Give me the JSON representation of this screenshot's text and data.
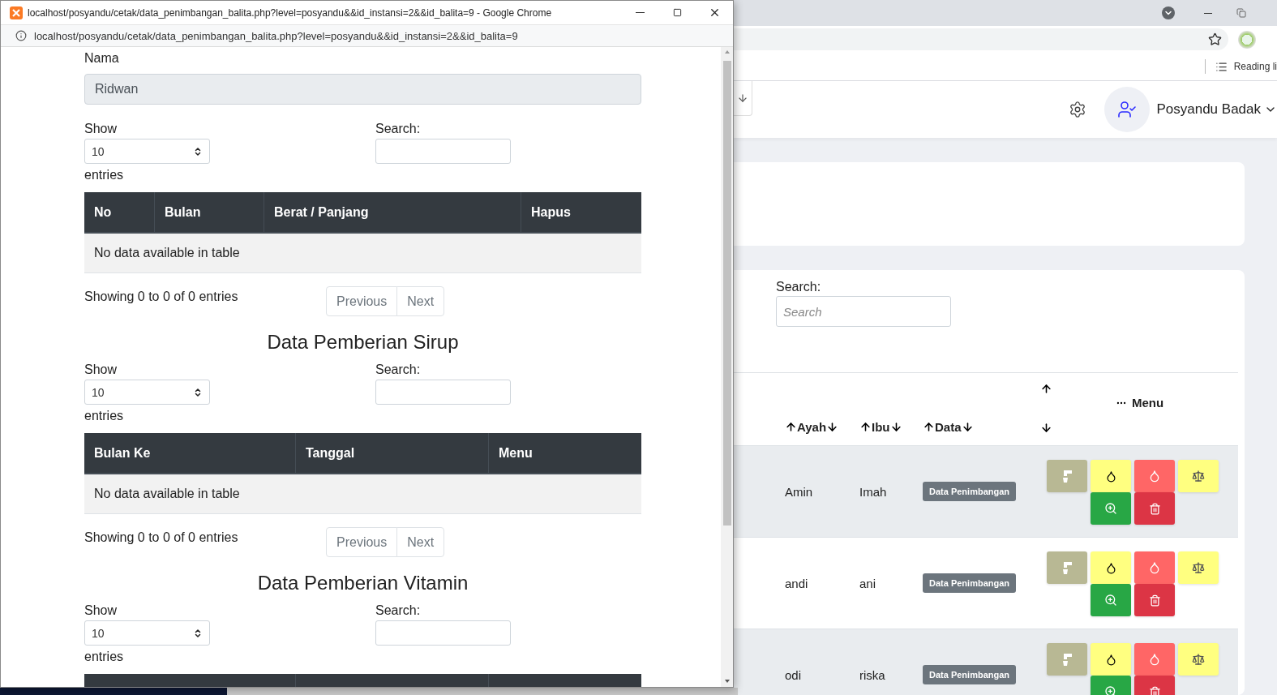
{
  "popup": {
    "title": "localhost/posyandu/cetak/data_penimbangan_balita.php?level=posyandu&&id_instansi=2&&id_balita=9 - Google Chrome",
    "url": "localhost/posyandu/cetak/data_penimbangan_balita.php?level=posyandu&&id_instansi=2&&id_balita=9",
    "nama_label": "Nama",
    "nama_value": "Ridwan",
    "sections": [
      {
        "show_label": "Show",
        "length": "10",
        "entries_label": "entries",
        "search_label": "Search:",
        "table": {
          "kind": "full",
          "columns": [
            "No",
            "Bulan",
            "Berat / Panjang",
            "Hapus"
          ],
          "empty_text": "No data available in table"
        },
        "info": "Showing 0 to 0 of 0 entries",
        "pager": [
          {
            "label": "Previous",
            "disabled": true
          },
          {
            "label": "Next",
            "disabled": true
          }
        ]
      },
      {
        "title": "Data Pemberian Sirup",
        "show_label": "Show",
        "length": "10",
        "entries_label": "entries",
        "search_label": "Search:",
        "table": {
          "kind": "full",
          "columns": [
            "Bulan Ke",
            "Tanggal",
            "Menu"
          ],
          "empty_text": "No data available in table"
        },
        "info": "Showing 0 to 0 of 0 entries",
        "pager": [
          {
            "label": "Previous",
            "disabled": true
          },
          {
            "label": "Next",
            "disabled": true
          }
        ]
      },
      {
        "title": "Data Pemberian Vitamin",
        "show_label": "Show",
        "length": "10",
        "entries_label": "entries",
        "search_label": "Search:",
        "table": {
          "kind": "cut-off"
        }
      }
    ]
  },
  "browser": {
    "bookmark": "Reading li",
    "user_name": "Posyandu Badak",
    "search_label": "Search:",
    "search_placeholder": "Search",
    "columns": [
      "Ayah",
      "Ibu",
      "Data"
    ],
    "menu_label": "Menu",
    "rows": [
      {
        "ayah": "Amin",
        "ibu": "Imah",
        "data": "Data Penimbangan"
      },
      {
        "ayah": "andi",
        "ibu": "ani",
        "data": "Data Penimbangan"
      },
      {
        "ayah": "odi",
        "ibu": "riska",
        "data": "Data Penimbangan"
      }
    ]
  }
}
